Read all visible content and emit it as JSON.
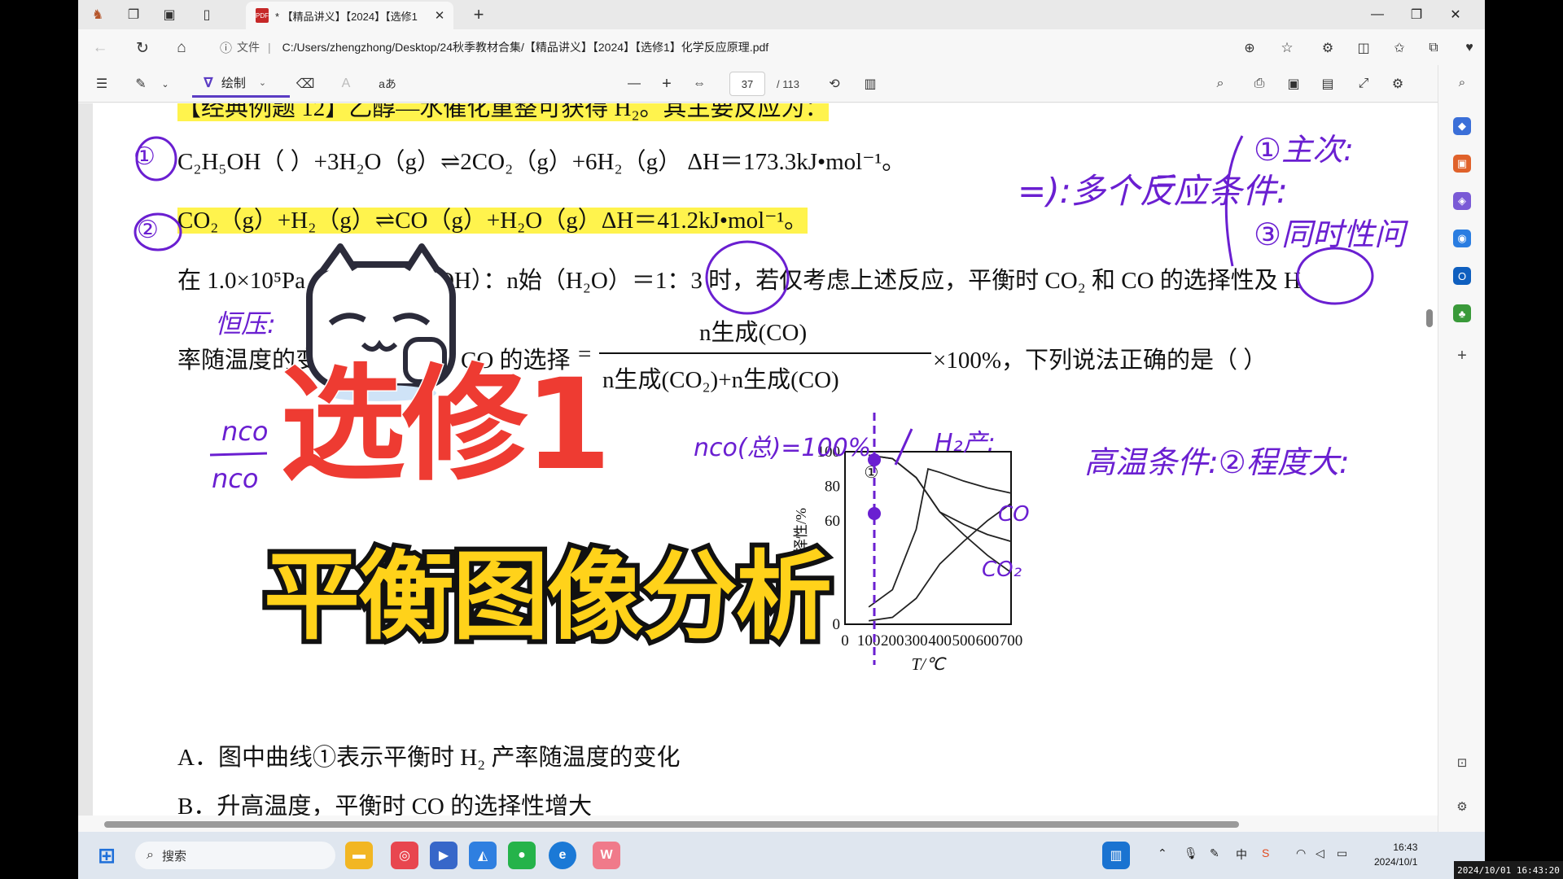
{
  "tab": {
    "title": "* 【精品讲义】【2024】【选修1",
    "close": "✕"
  },
  "window": {
    "minimize": "—",
    "restore": "❐",
    "close": "✕"
  },
  "address": {
    "file_label": "文件",
    "sep": "|",
    "url": "C:/Users/zhengzhong/Desktop/24秋季教材合集/【精品讲义】【2024】【选修1】化学反应原理.pdf"
  },
  "pdf_toolbar": {
    "draw_label": "绘制",
    "read_aloud": "aあ",
    "zoom_out": "—",
    "zoom_in": "+",
    "page_current": "37",
    "page_total": "/ 113"
  },
  "document": {
    "line0": "【经典例题 12】乙醇—水催化重整可获得 H₂。其主要反应为：",
    "line1": "C₂H₅OH（ ）+3H₂O（g）⇌2CO₂（g）+6H₂（g）  ΔH＝173.3kJ•mol⁻¹。",
    "line2": "CO₂（g）+H₂（g）⇌CO（g）+H₂O（g）ΔH＝41.2kJ•mol⁻¹。",
    "line3": "在 1.0×10⁵Pa，n始（C₂H₅OH）：n始（H₂O）＝1：3 时，若仅考虑上述反应，平衡时 CO₂ 和 CO 的选择性及 H",
    "line4_left": "率随温度的变化如图所示。CO 的选择",
    "line4_right": "×100%，下列说法正确的是（        ）",
    "frac_num": "n生成(CO)",
    "frac_den": "n生成(CO₂)+n生成(CO)",
    "option_a": "A．图中曲线①表示平衡时 H₂ 产率随温度的变化",
    "option_b": "B．升高温度，平衡时 CO 的选择性增大"
  },
  "handwriting": {
    "n1": "①",
    "n2": "②",
    "hengya": "恒压:",
    "duoge": "=):多个反应条件:",
    "zhuci": "①主次:",
    "tongshi": "③同时性问",
    "ncol": "nco(总)=100%",
    "h2_chan": "H₂产:",
    "gaowen": "高温条件:②程度大:",
    "co_lab": "CO",
    "co2_lab": "CO₂",
    "nco_a": "nco",
    "nco_b": "nco"
  },
  "overlay": {
    "title_red": "选修1",
    "title_yellow": "平衡图像分析"
  },
  "chart_data": {
    "type": "line",
    "xlabel": "T/℃",
    "ylabel": "选择性/%",
    "x_ticks": [
      "0",
      "100",
      "200",
      "300",
      "400",
      "500",
      "600",
      "700"
    ],
    "y_ticks": [
      "0",
      "60",
      "80",
      "100"
    ],
    "xlim": [
      0,
      700
    ],
    "ylim": [
      0,
      100
    ],
    "curve_label": "①",
    "series": [
      {
        "name": "①",
        "x": [
          100,
          200,
          300,
          400,
          500,
          600,
          700
        ],
        "y": [
          98,
          96,
          85,
          65,
          58,
          52,
          48
        ]
      },
      {
        "name": "",
        "x": [
          100,
          200,
          300,
          350,
          400,
          500,
          600,
          700
        ],
        "y": [
          10,
          20,
          55,
          90,
          88,
          83,
          79,
          76
        ]
      },
      {
        "name": "CO",
        "x": [
          100,
          200,
          300,
          400,
          500,
          600,
          700
        ],
        "y": [
          2,
          4,
          15,
          35,
          48,
          60,
          70
        ]
      },
      {
        "name": "CO₂",
        "x": [
          100,
          200,
          300,
          400,
          500,
          600,
          700
        ],
        "y": [
          98,
          96,
          85,
          65,
          52,
          40,
          30
        ]
      }
    ]
  },
  "taskbar": {
    "search": "搜索",
    "time": "16:43",
    "date": "2024/10/1",
    "lang": "中",
    "stamp": "2024/10/01 16:43:20"
  },
  "colors": {
    "accent": "#5b3cc4",
    "highlight": "#fff34d",
    "ink": "#6a1fd1",
    "title_red": "#ee3b32",
    "title_yellow": "#ffd21a"
  }
}
